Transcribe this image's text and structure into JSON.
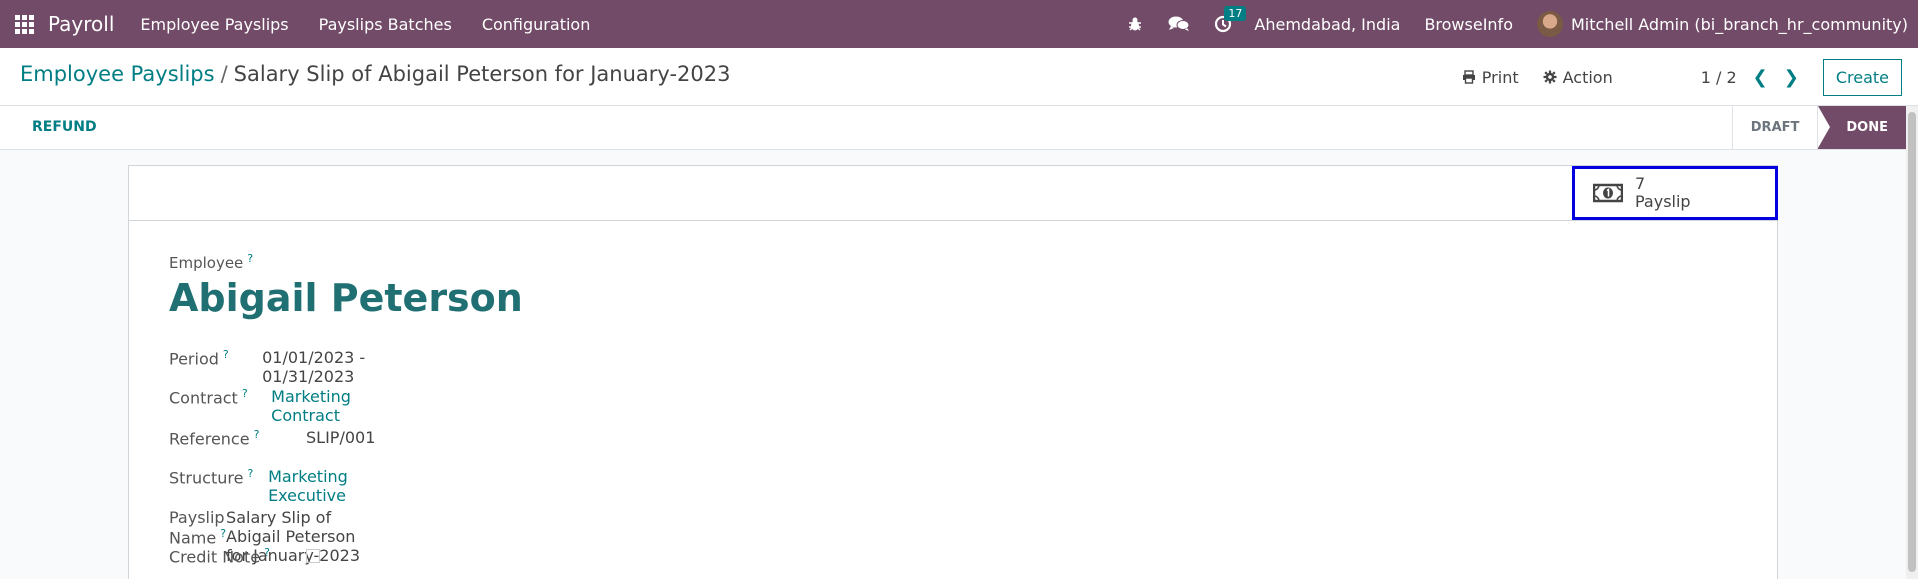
{
  "navbar": {
    "app_title": "Payroll",
    "menu": [
      "Employee Payslips",
      "Payslips Batches",
      "Configuration"
    ],
    "activity_count": "17",
    "company": "Ahemdabad, India",
    "workspace": "BrowseInfo",
    "user": "Mitchell Admin (bi_branch_hr_community)"
  },
  "breadcrumb": {
    "parent": "Employee Payslips",
    "separator": "/",
    "current": "Salary Slip of Abigail Peterson for January-2023"
  },
  "control": {
    "print_label": "Print",
    "action_label": "Action",
    "pager": "1 / 2",
    "create_label": "Create"
  },
  "statusbar": {
    "refund_label": "REFUND",
    "states": [
      "DRAFT",
      "DONE"
    ],
    "active_state": "DONE"
  },
  "smart_button": {
    "count": "7",
    "label": "Payslip"
  },
  "form": {
    "employee_label": "Employee",
    "employee_name": "Abigail Peterson",
    "help_mark": "?",
    "fields": {
      "period": {
        "label": "Period",
        "value": "01/01/2023 - 01/31/2023"
      },
      "contract": {
        "label": "Contract",
        "value": "Marketing Contract"
      },
      "reference": {
        "label": "Reference",
        "value": "SLIP/001"
      },
      "structure": {
        "label": "Structure",
        "value": "Marketing Executive"
      },
      "payslip_name": {
        "label": "Payslip Name",
        "value": "Salary Slip of Abigail Peterson for January-2023"
      },
      "credit_note": {
        "label": "Credit Note",
        "value": false
      }
    }
  },
  "colors": {
    "brand": "#714b67",
    "accent": "#017e84",
    "highlight_border": "#0000e0"
  }
}
